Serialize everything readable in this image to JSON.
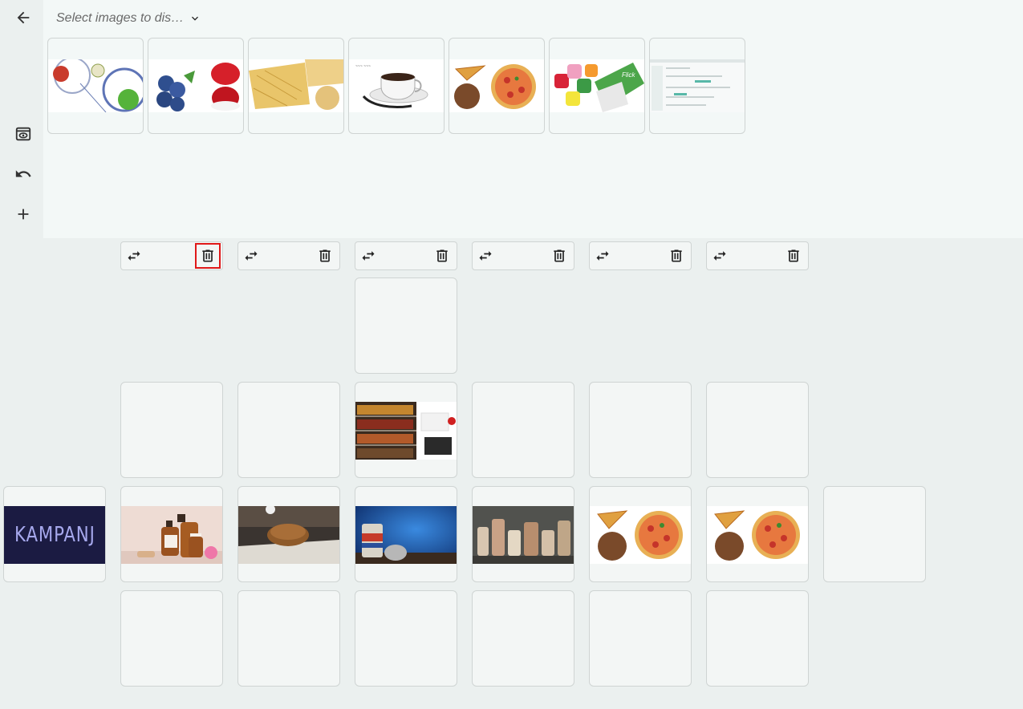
{
  "selector": {
    "placeholder": "Select images to dis…"
  },
  "rail": {
    "icons": [
      "arrow-left-icon",
      "preview-icon",
      "undo-icon",
      "plus-icon"
    ]
  },
  "thumbnails": [
    "fruits",
    "berries",
    "pasta",
    "coffee-cup",
    "pizza",
    "gum-packs",
    "document-screenshot"
  ],
  "grid_images": {
    "shelves": "shop-shelves",
    "kampanj": "KAMPANJ",
    "bottles": "cosmetic-bottles",
    "bread": "bread",
    "can": "beer-can",
    "jars": "jars",
    "pizza1": "pizza",
    "pizza2": "pizza"
  },
  "columns": 6,
  "colors": {
    "selected_outline": "#e01818",
    "panel_bg": "#f3f8f7",
    "page_bg": "#ebf0ef"
  }
}
